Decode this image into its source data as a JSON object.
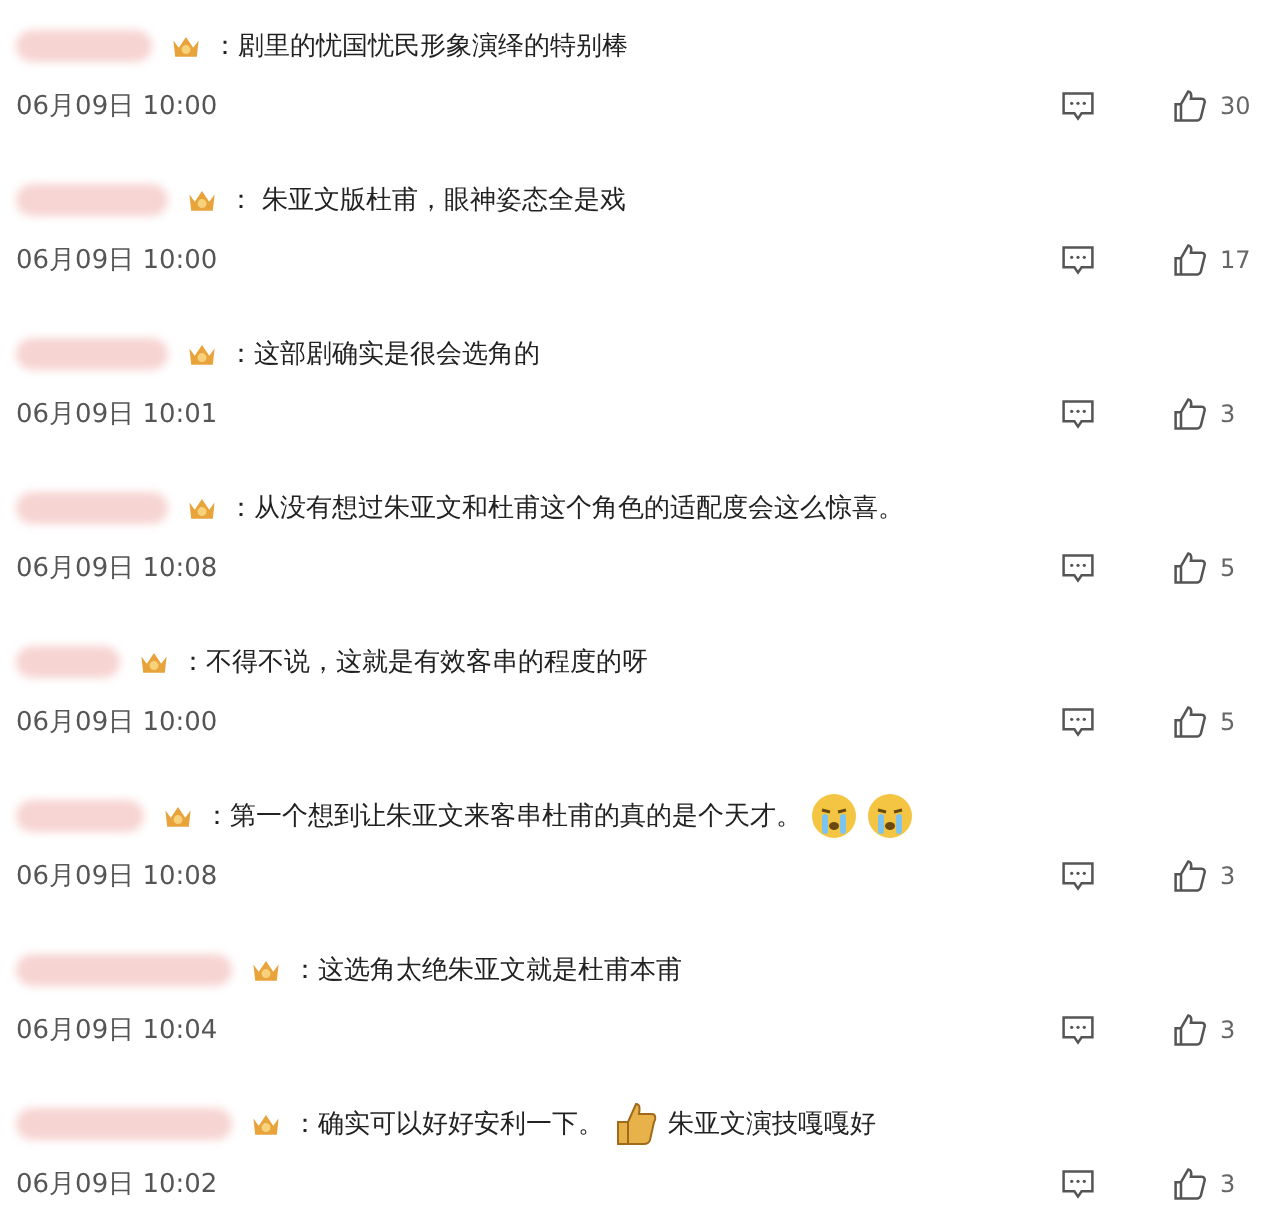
{
  "comments": [
    {
      "parts": [
        {
          "kind": "text",
          "text": "：剧里的忧国忧民形象演绎的特别棒"
        }
      ],
      "time": "06月09日 10:00",
      "likes": "30"
    },
    {
      "parts": [
        {
          "kind": "text",
          "text": "： 朱亚文版杜甫，眼神姿态全是戏"
        }
      ],
      "time": "06月09日 10:00",
      "likes": "17"
    },
    {
      "parts": [
        {
          "kind": "text",
          "text": "：这部剧确实是很会选角的"
        }
      ],
      "time": "06月09日 10:01",
      "likes": "3"
    },
    {
      "parts": [
        {
          "kind": "text",
          "text": "：从没有想过朱亚文和杜甫这个角色的适配度会这么惊喜。"
        }
      ],
      "time": "06月09日 10:08",
      "likes": "5"
    },
    {
      "parts": [
        {
          "kind": "text",
          "text": "：不得不说，这就是有效客串的程度的呀"
        }
      ],
      "time": "06月09日 10:00",
      "likes": "5"
    },
    {
      "parts": [
        {
          "kind": "text",
          "text": "：第一个想到让朱亚文来客串杜甫的真的是个天才。"
        },
        {
          "kind": "crying"
        },
        {
          "kind": "crying"
        }
      ],
      "time": "06月09日 10:08",
      "likes": "3"
    },
    {
      "parts": [
        {
          "kind": "text",
          "text": "：这选角太绝朱亚文就是杜甫本甫"
        }
      ],
      "time": "06月09日 10:04",
      "likes": "3"
    },
    {
      "parts": [
        {
          "kind": "text",
          "text": "：确实可以好好安利一下。"
        },
        {
          "kind": "thumbs"
        },
        {
          "kind": "text",
          "text": "朱亚文演技嘎嘎好"
        }
      ],
      "time": "06月09日 10:02",
      "likes": "3"
    }
  ]
}
